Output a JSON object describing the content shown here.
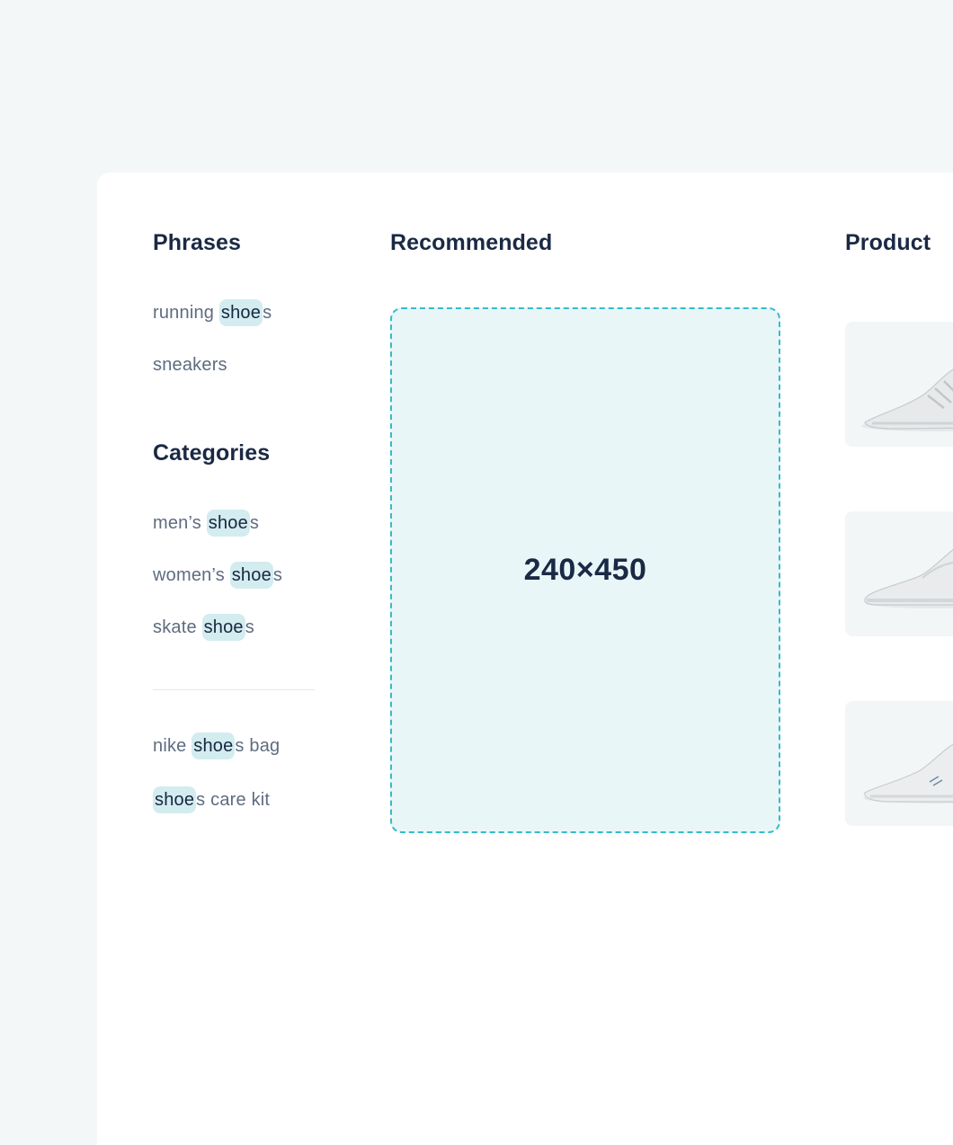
{
  "sections": {
    "phrases_title": "Phrases",
    "recommended_title": "Recommended",
    "product_title": "Product",
    "categories_title": "Categories"
  },
  "query_highlight": "shoe",
  "phrases": [
    {
      "pre": "running ",
      "hl": "shoe",
      "post": "s"
    },
    {
      "pre": "sneakers",
      "hl": "",
      "post": ""
    }
  ],
  "categories": [
    {
      "pre": "men’s ",
      "hl": "shoe",
      "post": "s"
    },
    {
      "pre": "women’s ",
      "hl": "shoe",
      "post": "s"
    },
    {
      "pre": "skate ",
      "hl": "shoe",
      "post": "s"
    }
  ],
  "other_suggestions": [
    {
      "pre": "nike ",
      "hl": "shoe",
      "post": "s bag"
    },
    {
      "pre": "",
      "hl": "shoe",
      "post": "s care kit"
    }
  ],
  "banner": {
    "label": "240×450"
  },
  "products": [
    {
      "image": "white-running-shoe-image"
    },
    {
      "image": "white-sneaker-image"
    },
    {
      "image": "white-trainer-image"
    }
  ],
  "colors": {
    "page_background": "#f3f7f8",
    "panel_background": "#ffffff",
    "heading_text": "#1a2944",
    "suggestion_text": "#5e6c80",
    "highlight_background": "#d3ecf0",
    "banner_border": "#35bccb",
    "banner_background": "#e9f6f8"
  }
}
